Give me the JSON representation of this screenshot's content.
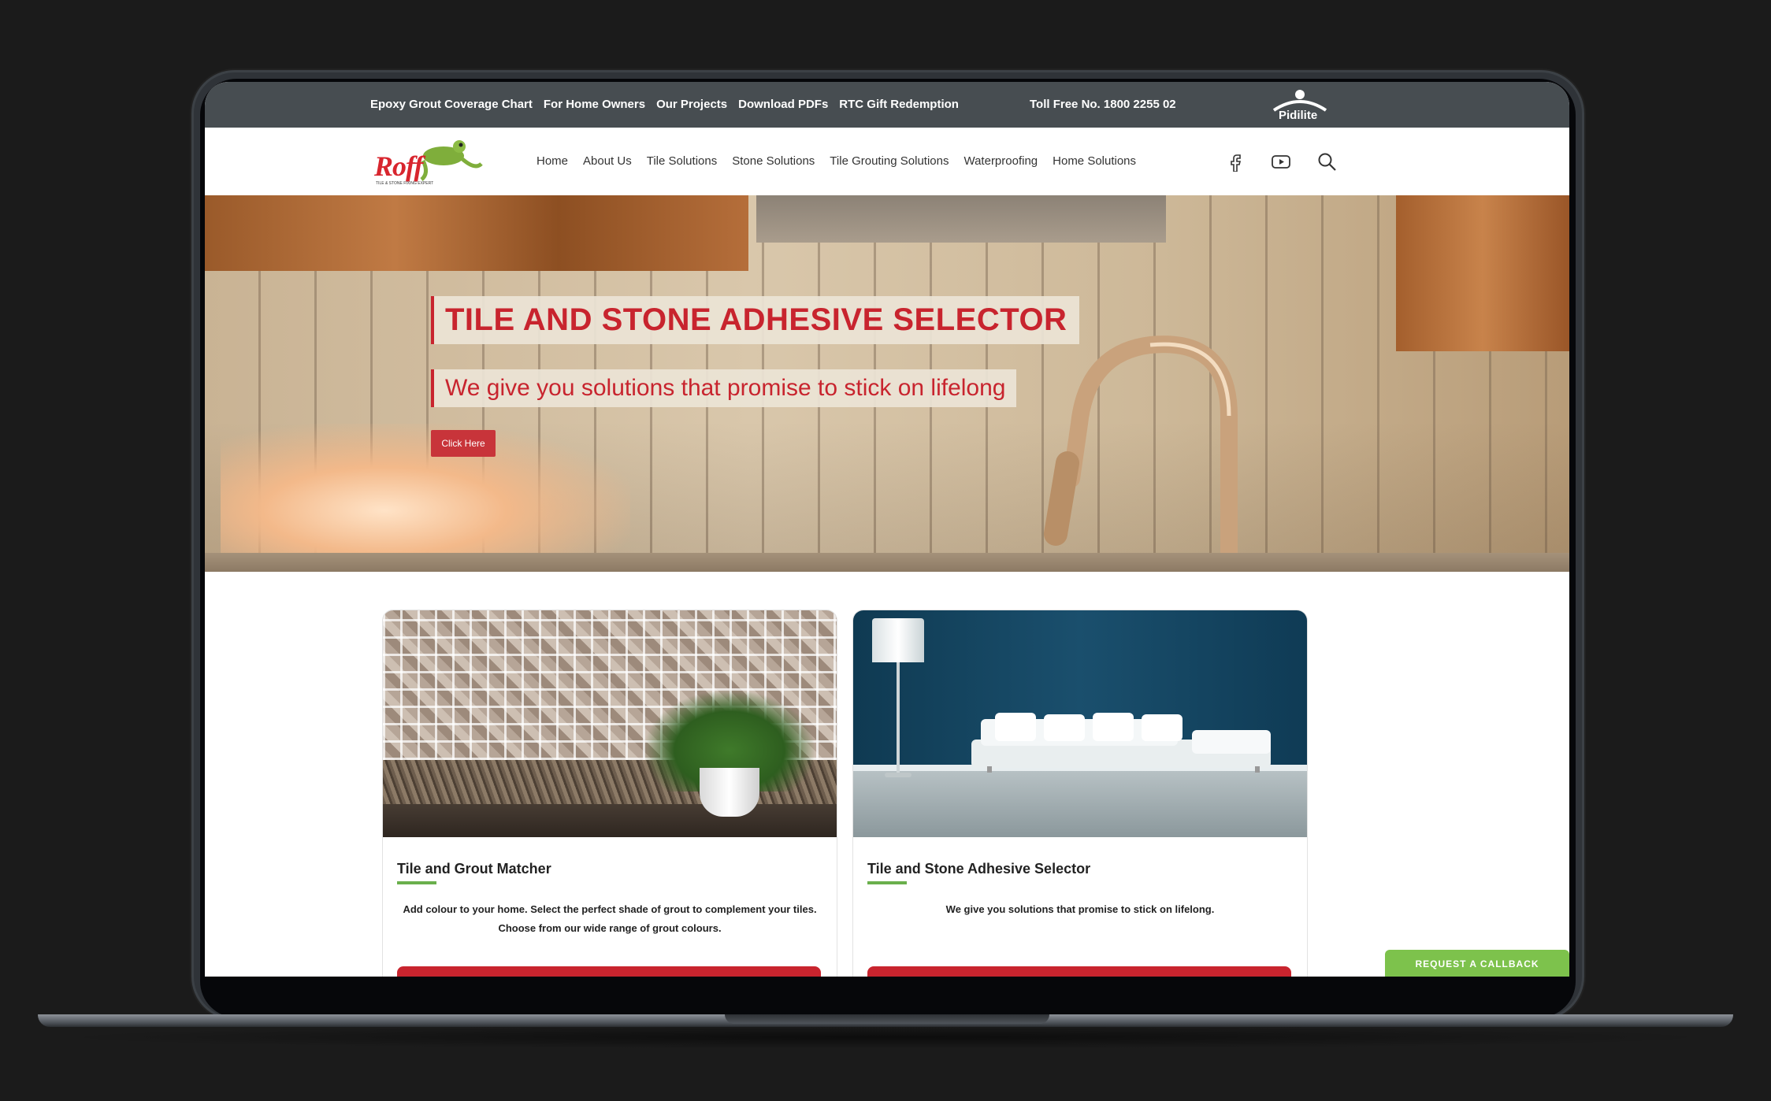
{
  "topbar": {
    "links": [
      "Epoxy Grout Coverage Chart",
      "For Home Owners",
      "Our Projects",
      "Download PDFs",
      "RTC Gift Redemption"
    ],
    "toll_free": "Toll Free No. 1800 2255 02",
    "brand": "Pidilite"
  },
  "logo": {
    "name": "Roff",
    "tagline": "TILE & STONE FIXING EXPERT"
  },
  "nav": {
    "items": [
      "Home",
      "About Us",
      "Tile Solutions",
      "Stone Solutions",
      "Tile Grouting Solutions",
      "Waterproofing",
      "Home Solutions"
    ],
    "icons": [
      "facebook-icon",
      "youtube-icon",
      "search-icon"
    ]
  },
  "hero": {
    "title": "TILE AND STONE ADHESIVE SELECTOR",
    "subtitle": "We give you solutions that promise to stick on lifelong",
    "button": "Click Here"
  },
  "cards": [
    {
      "title": "Tile and Grout Matcher",
      "description": "Add colour to your home. Select the perfect shade of grout to complement your tiles. Choose from our wide range of grout colours."
    },
    {
      "title": "Tile and Stone Adhesive Selector",
      "description": "We give you solutions that promise to stick on lifelong."
    }
  ],
  "callback": "REQUEST A CALLBACK",
  "colors": {
    "brand_red": "#c8242e",
    "accent_green": "#6ab04c",
    "topbar": "#474d51"
  }
}
